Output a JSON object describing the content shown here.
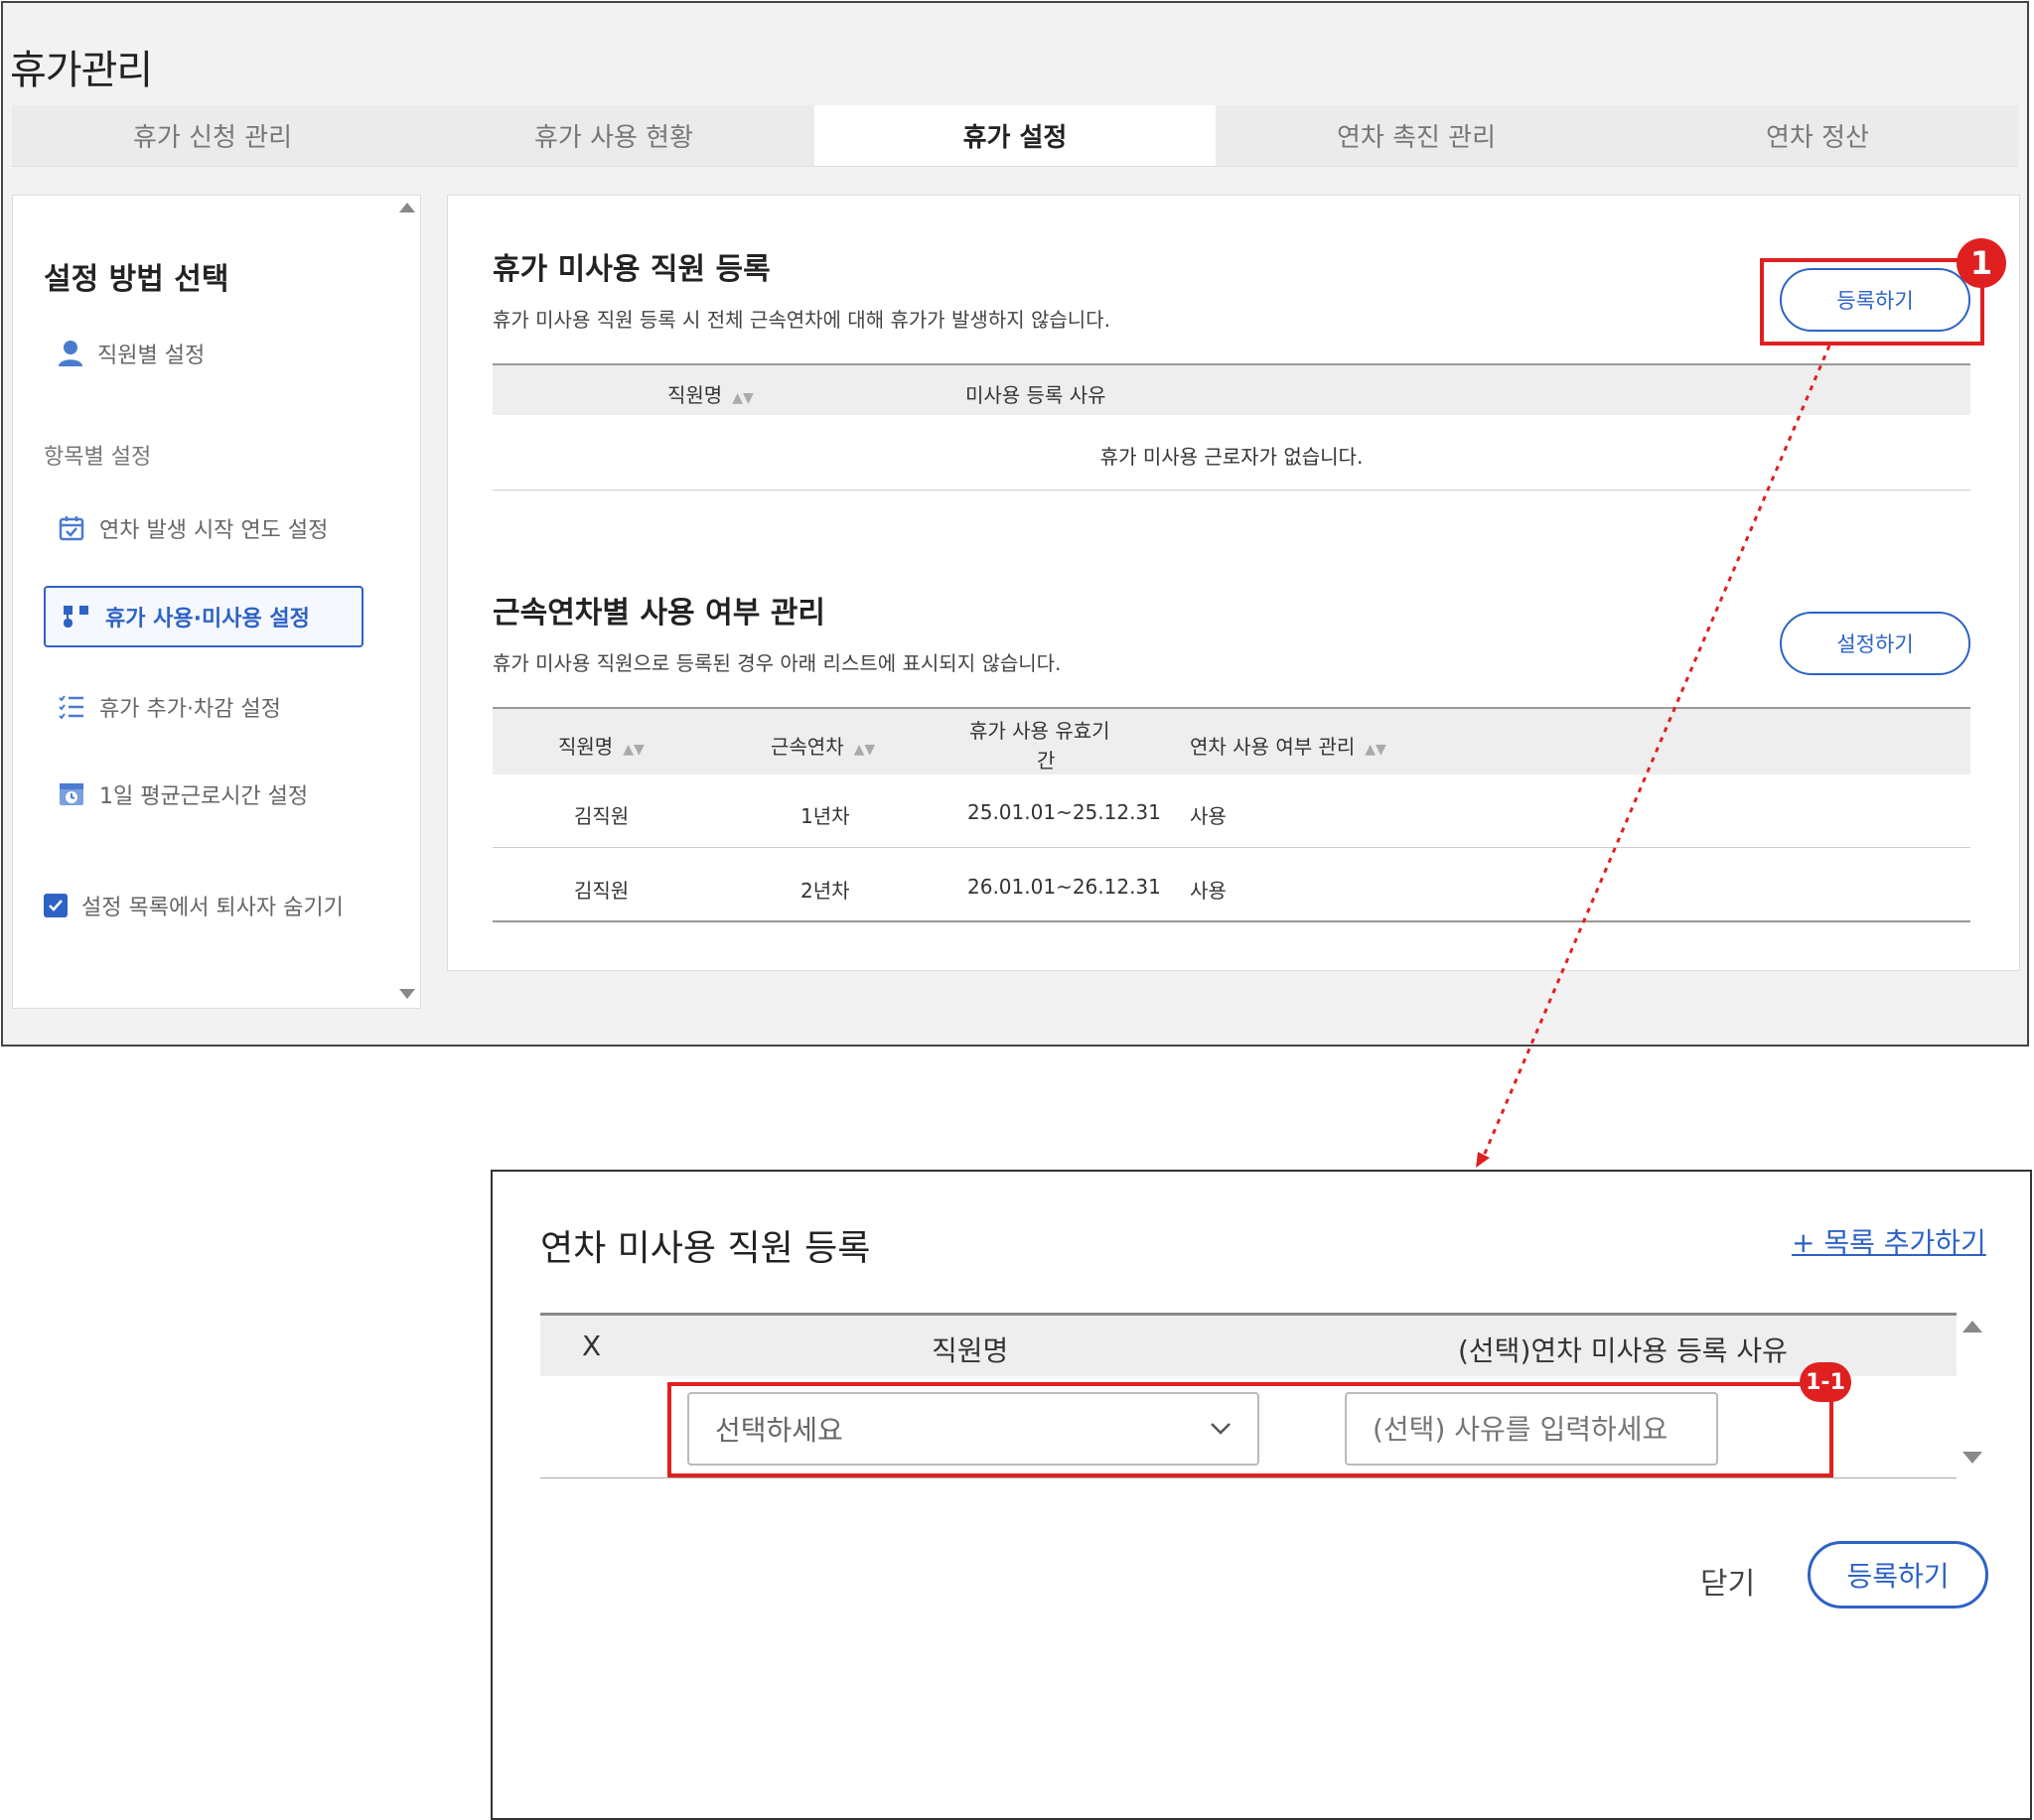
{
  "app": {
    "title": "휴가관리"
  },
  "tabs": [
    {
      "label": "휴가 신청 관리"
    },
    {
      "label": "휴가 사용 현황"
    },
    {
      "label": "휴가 설정"
    },
    {
      "label": "연차 촉진 관리"
    },
    {
      "label": "연차 정산"
    }
  ],
  "sidebar": {
    "title": "설정 방법 선택",
    "employee_setting": "직원별 설정",
    "section_label": "항목별 설정",
    "items": [
      {
        "label": "연차 발생 시작 연도 설정"
      },
      {
        "label": "휴가 사용·미사용 설정"
      },
      {
        "label": "휴가 추가·차감 설정"
      },
      {
        "label": "1일 평균근로시간 설정"
      }
    ],
    "hide_retired": "설정 목록에서 퇴사자 숨기기"
  },
  "section1": {
    "title": "휴가 미사용 직원 등록",
    "desc": "휴가 미사용 직원 등록 시 전체 근속연차에 대해 휴가가 발생하지 않습니다.",
    "button": "등록하기",
    "columns": [
      "직원명",
      "미사용 등록 사유"
    ],
    "empty": "휴가 미사용 근로자가 없습니다."
  },
  "section2": {
    "title": "근속연차별 사용 여부 관리",
    "desc": "휴가 미사용 직원으로 등록된 경우 아래 리스트에 표시되지 않습니다.",
    "button": "설정하기",
    "columns": [
      "직원명",
      "근속연차",
      "휴가 사용 유효기",
      "간",
      "연차 사용 여부 관리"
    ],
    "rows": [
      {
        "name": "김직원",
        "year": "1년차",
        "period": "25.01.01~25.12.31",
        "usage": "사용"
      },
      {
        "name": "김직원",
        "year": "2년차",
        "period": "26.01.01~26.12.31",
        "usage": "사용"
      }
    ]
  },
  "badges": {
    "b1": "1",
    "b2": "1-1"
  },
  "modal": {
    "title": "연차 미사용 직원 등록",
    "add_link": "+ 목록 추가하기",
    "columns": [
      "X",
      "직원명",
      "(선택)연차 미사용 등록 사유"
    ],
    "select_placeholder": "선택하세요",
    "reason_placeholder": "(선택) 사유를 입력하세요",
    "close": "닫기",
    "register": "등록하기"
  },
  "colors": {
    "accent": "#2d62c6",
    "highlight": "#e02020"
  }
}
